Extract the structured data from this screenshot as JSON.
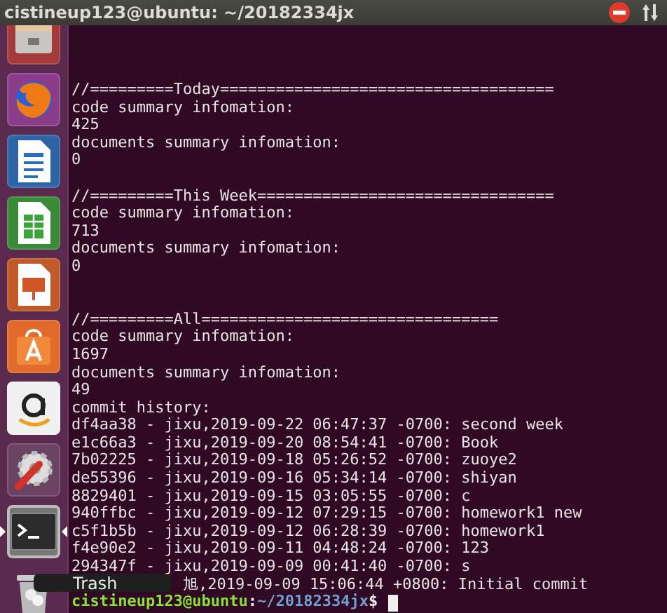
{
  "window": {
    "title": "cistineup123@ubuntu: ~/20182334jx"
  },
  "launcher": [
    {
      "kind": "files",
      "selected": false
    },
    {
      "kind": "firefox",
      "selected": false
    },
    {
      "kind": "writer",
      "selected": false
    },
    {
      "kind": "calc",
      "selected": false
    },
    {
      "kind": "impress",
      "selected": false
    },
    {
      "kind": "software",
      "selected": false
    },
    {
      "kind": "amazon",
      "selected": false
    },
    {
      "kind": "settings",
      "selected": false
    },
    {
      "kind": "terminal",
      "selected": true
    },
    {
      "kind": "trash",
      "selected": false
    }
  ],
  "tooltip": "Trash",
  "terminal": {
    "lines": [
      {
        "kind": "line",
        "text": "//=========Today===================================="
      },
      {
        "kind": "line",
        "text": "code summary infomation:"
      },
      {
        "kind": "line",
        "text": "425"
      },
      {
        "kind": "line",
        "text": "documents summary infomation:"
      },
      {
        "kind": "line",
        "text": "0"
      },
      {
        "kind": "blank"
      },
      {
        "kind": "line",
        "text": "//=========This Week================================"
      },
      {
        "kind": "line",
        "text": "code summary infomation:"
      },
      {
        "kind": "line",
        "text": "713"
      },
      {
        "kind": "line",
        "text": "documents summary infomation:"
      },
      {
        "kind": "line",
        "text": "0"
      },
      {
        "kind": "blank"
      },
      {
        "kind": "blank"
      },
      {
        "kind": "line",
        "text": "//=========All================================"
      },
      {
        "kind": "line",
        "text": "code summary infomation:"
      },
      {
        "kind": "line",
        "text": "1697"
      },
      {
        "kind": "line",
        "text": "documents summary infomation:"
      },
      {
        "kind": "line",
        "text": "49"
      },
      {
        "kind": "line",
        "text": "commit history:"
      },
      {
        "kind": "line",
        "text": "df4aa38 - jixu,2019-09-22 06:47:37 -0700: second week"
      },
      {
        "kind": "line",
        "text": "e1c66a3 - jixu,2019-09-20 08:54:41 -0700: Book"
      },
      {
        "kind": "line",
        "text": "7b02225 - jixu,2019-09-18 05:26:52 -0700: zuoye2"
      },
      {
        "kind": "line",
        "text": "de55396 - jixu,2019-09-16 05:34:14 -0700: shiyan"
      },
      {
        "kind": "line",
        "text": "8829401 - jixu,2019-09-15 03:05:55 -0700: c"
      },
      {
        "kind": "line",
        "text": "940ffbc - jixu,2019-09-12 07:29:15 -0700: homework1 new"
      },
      {
        "kind": "line",
        "text": "c5f1b5b - jixu,2019-09-12 06:28:39 -0700: homework1"
      },
      {
        "kind": "line",
        "text": "f4e90e2 - jixu,2019-09-11 04:48:24 -0700: 123"
      },
      {
        "kind": "line",
        "text": "294347f - jixu,2019-09-09 00:41:40 -0700: s"
      },
      {
        "kind": "partial",
        "text": "旭,2019-09-09 15:06:44 +0800: Initial commit"
      }
    ],
    "prompt": {
      "user": "cistineup123@ubuntu",
      "separator": ":",
      "path": "~/20182334jx",
      "symbol": "$"
    }
  }
}
